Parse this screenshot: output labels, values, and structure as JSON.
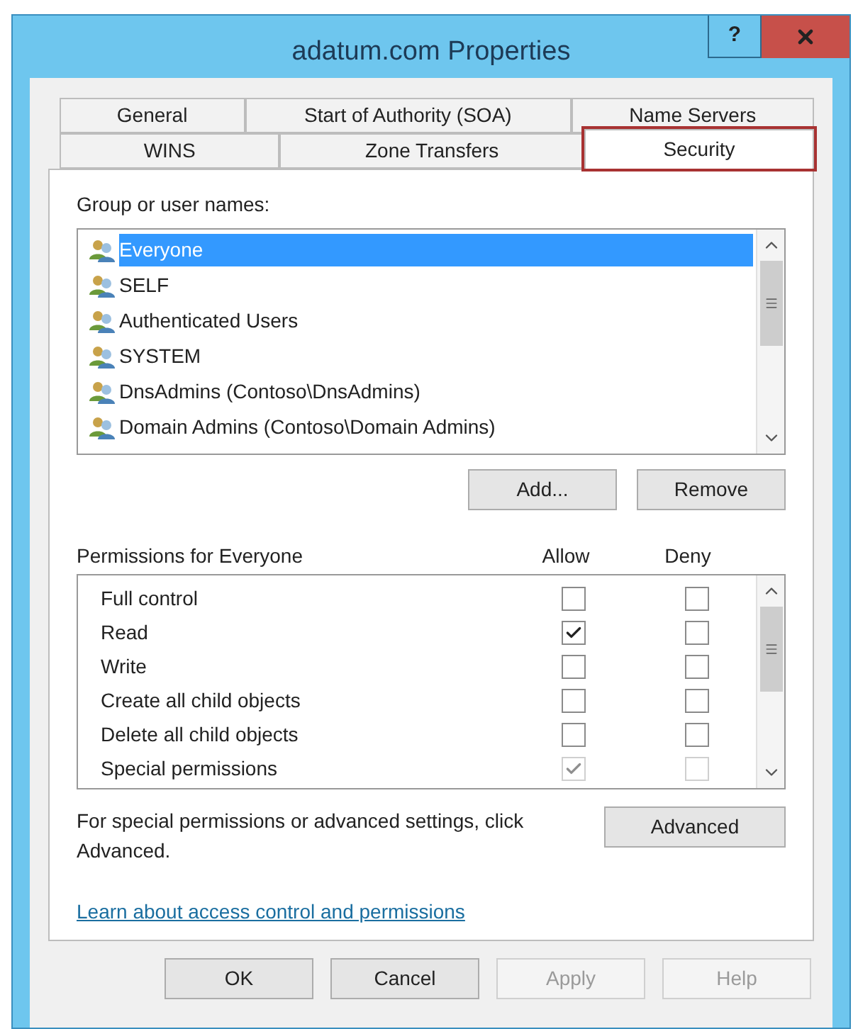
{
  "window": {
    "title": "adatum.com Properties",
    "help_button": "?"
  },
  "tab_rows": [
    [
      {
        "label": "General",
        "selected": false,
        "highlighted": false
      },
      {
        "label": "Start of Authority (SOA)",
        "selected": false,
        "highlighted": false
      },
      {
        "label": "Name Servers",
        "selected": false,
        "highlighted": false
      }
    ],
    [
      {
        "label": "WINS",
        "selected": false,
        "highlighted": false
      },
      {
        "label": "Zone Transfers",
        "selected": false,
        "highlighted": false
      },
      {
        "label": "Security",
        "selected": true,
        "highlighted": true
      }
    ]
  ],
  "group_list": {
    "label": "Group or user names:",
    "items": [
      {
        "name": "Everyone",
        "selected": true
      },
      {
        "name": "SELF",
        "selected": false
      },
      {
        "name": "Authenticated Users",
        "selected": false
      },
      {
        "name": "SYSTEM",
        "selected": false
      },
      {
        "name": "DnsAdmins (Contoso\\DnsAdmins)",
        "selected": false
      },
      {
        "name": "Domain Admins (Contoso\\Domain Admins)",
        "selected": false
      }
    ]
  },
  "group_buttons": [
    "Add...",
    "Remove"
  ],
  "permissions": {
    "label": "Permissions for Everyone",
    "allow_header": "Allow",
    "deny_header": "Deny",
    "rows": [
      {
        "name": "Full control",
        "allow": false,
        "allow_disabled": false,
        "deny": false,
        "deny_disabled": false
      },
      {
        "name": "Read",
        "allow": true,
        "allow_disabled": false,
        "deny": false,
        "deny_disabled": false
      },
      {
        "name": "Write",
        "allow": false,
        "allow_disabled": false,
        "deny": false,
        "deny_disabled": false
      },
      {
        "name": "Create all child objects",
        "allow": false,
        "allow_disabled": false,
        "deny": false,
        "deny_disabled": false
      },
      {
        "name": "Delete all child objects",
        "allow": false,
        "allow_disabled": false,
        "deny": false,
        "deny_disabled": false
      },
      {
        "name": "Special permissions",
        "allow": true,
        "allow_disabled": true,
        "deny": false,
        "deny_disabled": true
      }
    ]
  },
  "advanced_note": "For special permissions or advanced settings, click Advanced.",
  "advanced_button": "Advanced",
  "learn_link": "Learn about access control and permissions",
  "dialog_buttons": [
    {
      "label": "OK",
      "disabled": false
    },
    {
      "label": "Cancel",
      "disabled": false
    },
    {
      "label": "Apply",
      "disabled": true
    },
    {
      "label": "Help",
      "disabled": true
    }
  ]
}
